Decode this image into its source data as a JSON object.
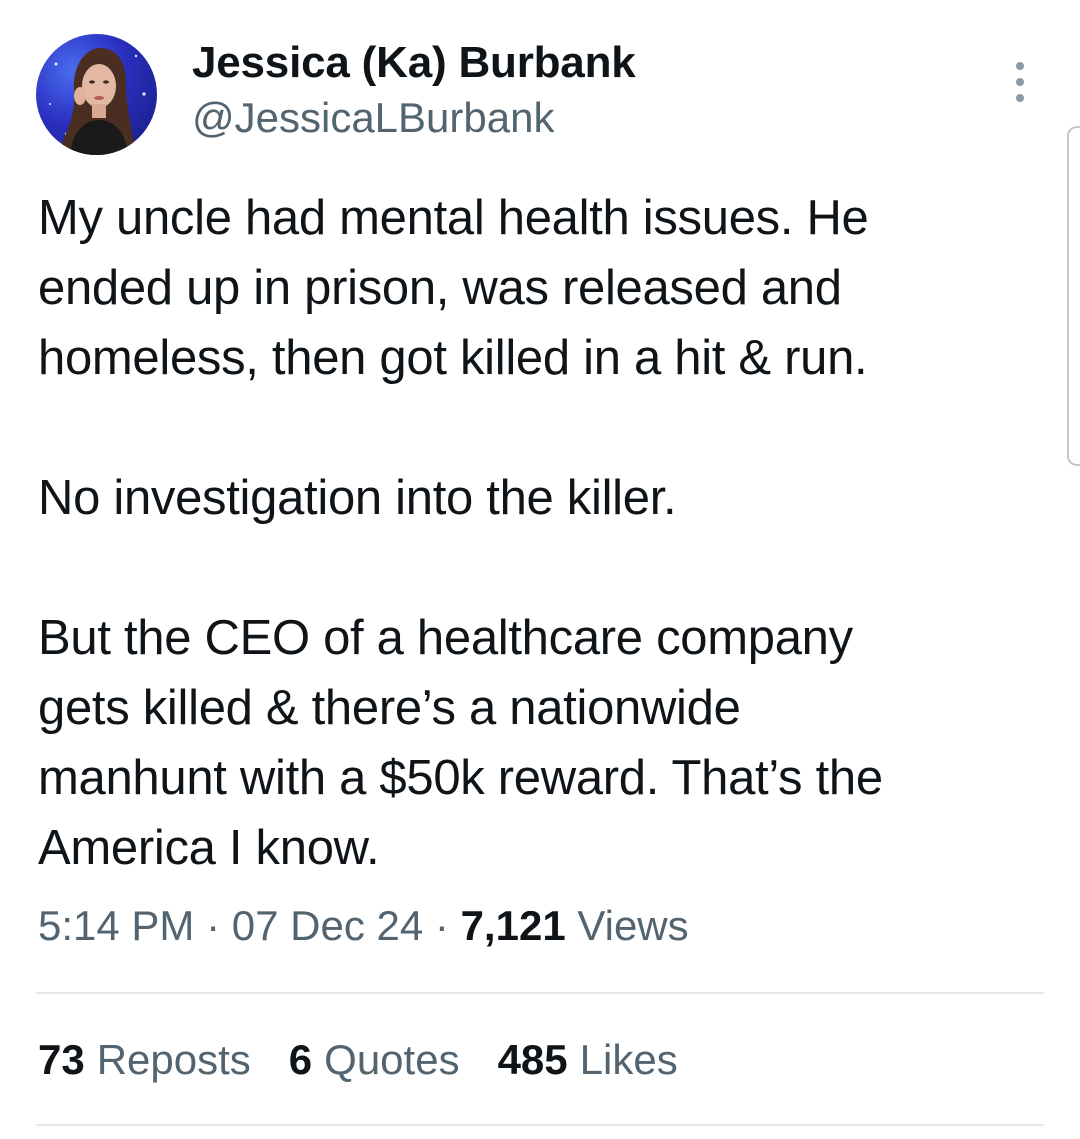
{
  "author": {
    "name": "Jessica (Ka) Burbank",
    "handle": "@JessicaLBurbank"
  },
  "tweet": {
    "lines": [
      "My uncle had mental health issues. He",
      "ended up in prison, was released and",
      "homeless, then got killed in a hit & run.",
      "",
      "No investigation into the killer.",
      "",
      "But the CEO of a healthcare company",
      "gets killed & there’s a nationwide",
      "manhunt with a $50k reward. That’s the",
      "America I know."
    ]
  },
  "meta": {
    "time": "5:14 PM",
    "separator": "·",
    "date": "07 Dec 24",
    "views_count": "7,121",
    "views_label": "Views"
  },
  "stats": {
    "reposts_count": "73",
    "reposts_label": "Reposts",
    "quotes_count": "6",
    "quotes_label": "Quotes",
    "likes_count": "485",
    "likes_label": "Likes"
  },
  "icons": {
    "more": "more-vertical-icon"
  },
  "colors": {
    "text_primary": "#0f1419",
    "text_secondary": "#536471",
    "divider": "#e6e9eb",
    "avatar_background": "#2a2fbf"
  }
}
